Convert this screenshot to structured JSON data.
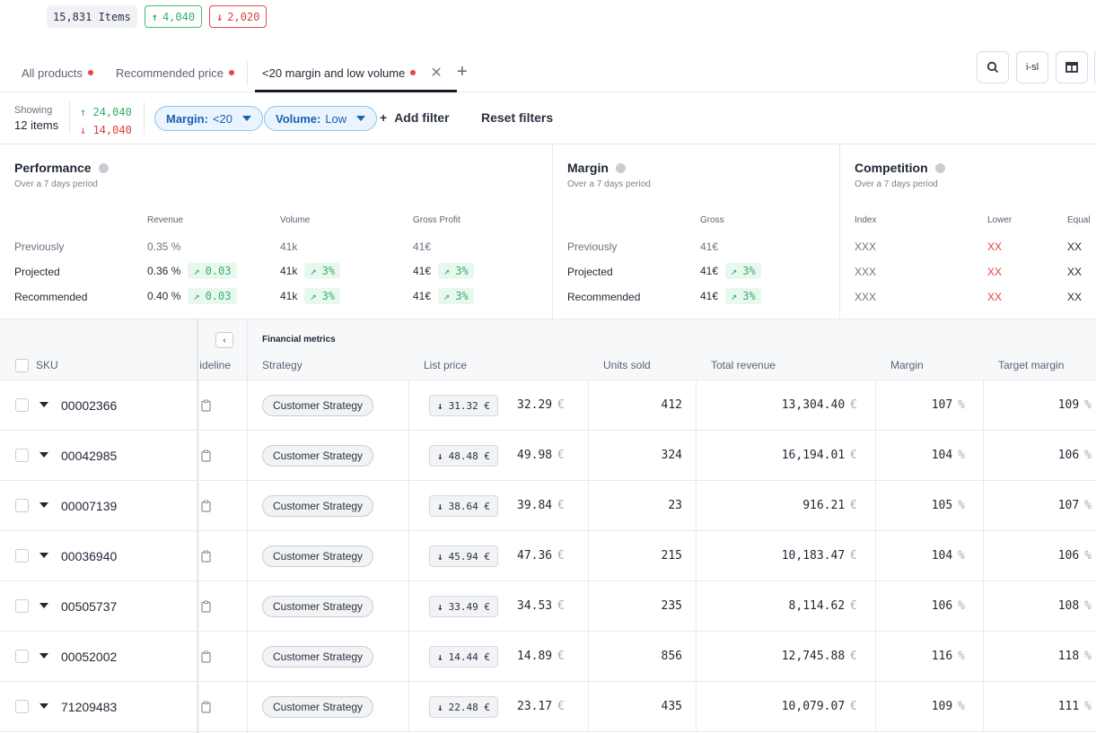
{
  "top_stats": {
    "items": "15,831 Items",
    "up": "4,040",
    "down": "2,020"
  },
  "tabs": [
    {
      "label": "All products",
      "active": false
    },
    {
      "label": "Recommended price",
      "active": false
    },
    {
      "label": "<20 margin and low volume",
      "active": true
    }
  ],
  "toolbar": {
    "search_icon": "search-icon",
    "middle_btn_text": "i-sl",
    "columns_icon": "columns-icon"
  },
  "filters": {
    "showing_label": "Showing",
    "showing_value": "12 items",
    "delta_up": "24,040",
    "delta_down": "14,040",
    "pills": [
      {
        "key": "Margin:",
        "value": "<20"
      },
      {
        "key": "Volume:",
        "value": "Low"
      }
    ],
    "add_filter": "Add filter",
    "reset_filters": "Reset filters"
  },
  "summary": {
    "performance": {
      "title": "Performance",
      "subtitle": "Over a 7 days period",
      "columns": [
        "Revenue",
        "Volume",
        "Gross Profit"
      ],
      "rows": [
        {
          "label": "Previously",
          "values": [
            "0.35 %",
            "41k",
            "41€"
          ],
          "gains": [
            null,
            null,
            null
          ]
        },
        {
          "label": "Projected",
          "values": [
            "0.36 %",
            "41k",
            "41€"
          ],
          "gains": [
            "0.03",
            "3%",
            "3%"
          ]
        },
        {
          "label": "Recommended",
          "values": [
            "0.40 %",
            "41k",
            "41€"
          ],
          "gains": [
            "0.03",
            "3%",
            "3%"
          ]
        }
      ]
    },
    "margin": {
      "title": "Margin",
      "subtitle": "Over a 7 days period",
      "columns": [
        "Gross"
      ],
      "rows": [
        {
          "label": "Previously",
          "values": [
            "41€"
          ],
          "gains": [
            null
          ]
        },
        {
          "label": "Projected",
          "values": [
            "41€"
          ],
          "gains": [
            "3%"
          ]
        },
        {
          "label": "Recommended",
          "values": [
            "41€"
          ],
          "gains": [
            "3%"
          ]
        }
      ]
    },
    "competition": {
      "title": "Competition",
      "subtitle": "Over a 7 days period",
      "columns": [
        "Index",
        "Lower",
        "Equal"
      ],
      "rows": [
        [
          "XXX",
          "XX",
          "XX"
        ],
        [
          "XXX",
          "XX",
          "XX"
        ],
        [
          "XXX",
          "XX",
          "XX"
        ]
      ]
    }
  },
  "table": {
    "group_label": "Financial metrics",
    "columns": [
      "SKU",
      "ideline",
      "Strategy",
      "List price",
      "Units sold",
      "Total revenue",
      "Margin",
      "Target margin"
    ],
    "currency": "€",
    "percent": "%",
    "rows": [
      {
        "sku": "00002366",
        "strategy": "Customer Strategy",
        "rec_price": "31.32 €",
        "list_price": "32.29",
        "units": "412",
        "revenue": "13,304.40",
        "margin": "107",
        "target": "109"
      },
      {
        "sku": "00042985",
        "strategy": "Customer Strategy",
        "rec_price": "48.48 €",
        "list_price": "49.98",
        "units": "324",
        "revenue": "16,194.01",
        "margin": "104",
        "target": "106"
      },
      {
        "sku": "00007139",
        "strategy": "Customer Strategy",
        "rec_price": "38.64 €",
        "list_price": "39.84",
        "units": "23",
        "revenue": "916.21",
        "margin": "105",
        "target": "107"
      },
      {
        "sku": "00036940",
        "strategy": "Customer Strategy",
        "rec_price": "45.94 €",
        "list_price": "47.36",
        "units": "215",
        "revenue": "10,183.47",
        "margin": "104",
        "target": "106"
      },
      {
        "sku": "00505737",
        "strategy": "Customer Strategy",
        "rec_price": "33.49 €",
        "list_price": "34.53",
        "units": "235",
        "revenue": "8,114.62",
        "margin": "106",
        "target": "108"
      },
      {
        "sku": "00052002",
        "strategy": "Customer Strategy",
        "rec_price": "14.44 €",
        "list_price": "14.89",
        "units": "856",
        "revenue": "12,745.88",
        "margin": "116",
        "target": "118"
      },
      {
        "sku": "71209483",
        "strategy": "Customer Strategy",
        "rec_price": "22.48 €",
        "list_price": "23.17",
        "units": "435",
        "revenue": "10,079.07",
        "margin": "109",
        "target": "111"
      }
    ]
  }
}
